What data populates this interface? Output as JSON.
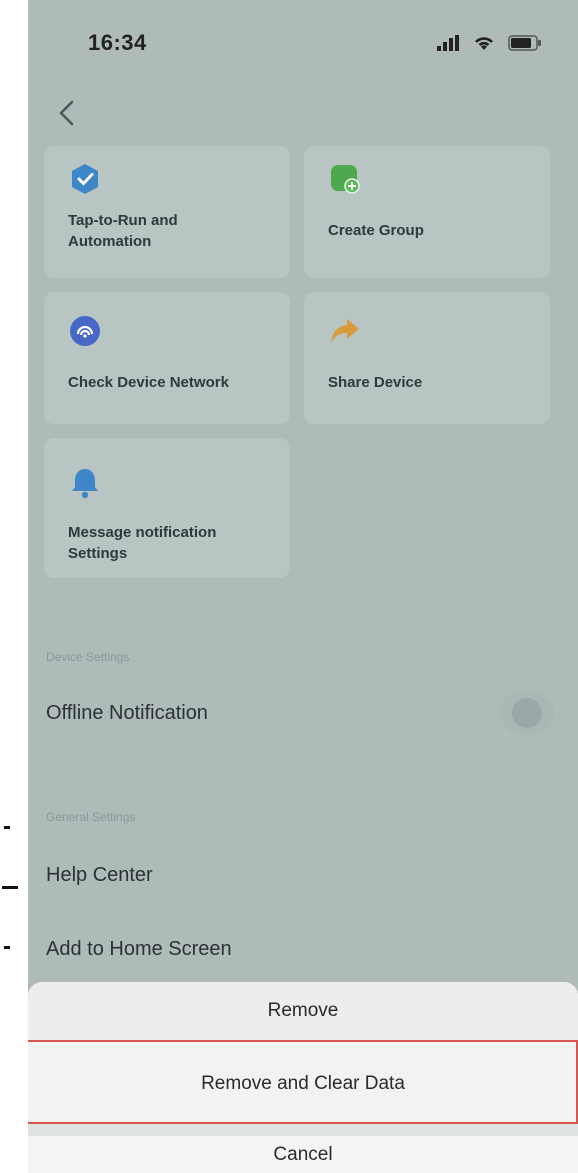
{
  "status_bar": {
    "time": "16:34"
  },
  "tiles": [
    {
      "label": "Tap-to-Run and\nAutomation",
      "icon": "automation-check-icon",
      "color": "#3d86c8"
    },
    {
      "label": "Create Group",
      "icon": "create-group-icon",
      "color": "#4ea84e"
    },
    {
      "label": "Check Device Network",
      "icon": "network-check-icon",
      "color": "#4868c8"
    },
    {
      "label": "Share Device",
      "icon": "share-arrow-icon",
      "color": "#d99b3a"
    },
    {
      "label": "Message notification\nSettings",
      "icon": "bell-icon",
      "color": "#3f86c8"
    }
  ],
  "sections": {
    "device_settings": "Device Settings",
    "general_settings": "General Settings"
  },
  "rows": {
    "offline_notification": "Offline Notification",
    "help_center": "Help Center",
    "add_to_home": "Add to Home Screen"
  },
  "action_sheet": {
    "remove": "Remove",
    "remove_clear": "Remove and Clear Data",
    "cancel": "Cancel"
  }
}
